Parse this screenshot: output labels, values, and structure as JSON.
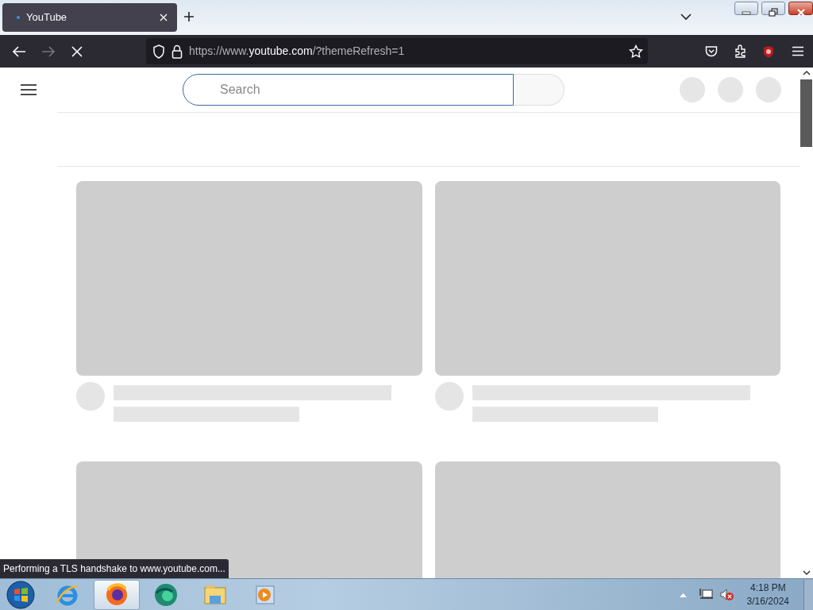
{
  "tabs": [
    {
      "title": "YouTube",
      "selected": true
    }
  ],
  "toolbar": {
    "loading": true,
    "url_prefix": "https://www.",
    "url_host": "youtube.com",
    "url_suffix": "/?themeRefresh=1"
  },
  "page": {
    "search": {
      "placeholder": "Search"
    },
    "feed": [
      {
        "kind": "skeleton"
      },
      {
        "kind": "skeleton"
      },
      {
        "kind": "thumbnail"
      },
      {
        "kind": "thumbnail"
      }
    ]
  },
  "status_bar": {
    "text": "Performing a TLS handshake to www.youtube.com..."
  },
  "taskbar": {
    "apps": [
      {
        "kind": "ie",
        "selected": false
      },
      {
        "kind": "firefox",
        "selected": true
      },
      {
        "kind": "edge",
        "selected": false
      },
      {
        "kind": "explorer",
        "selected": false
      },
      {
        "kind": "media",
        "selected": false
      }
    ],
    "time": "4:18 PM",
    "date": "3/16/2024"
  }
}
